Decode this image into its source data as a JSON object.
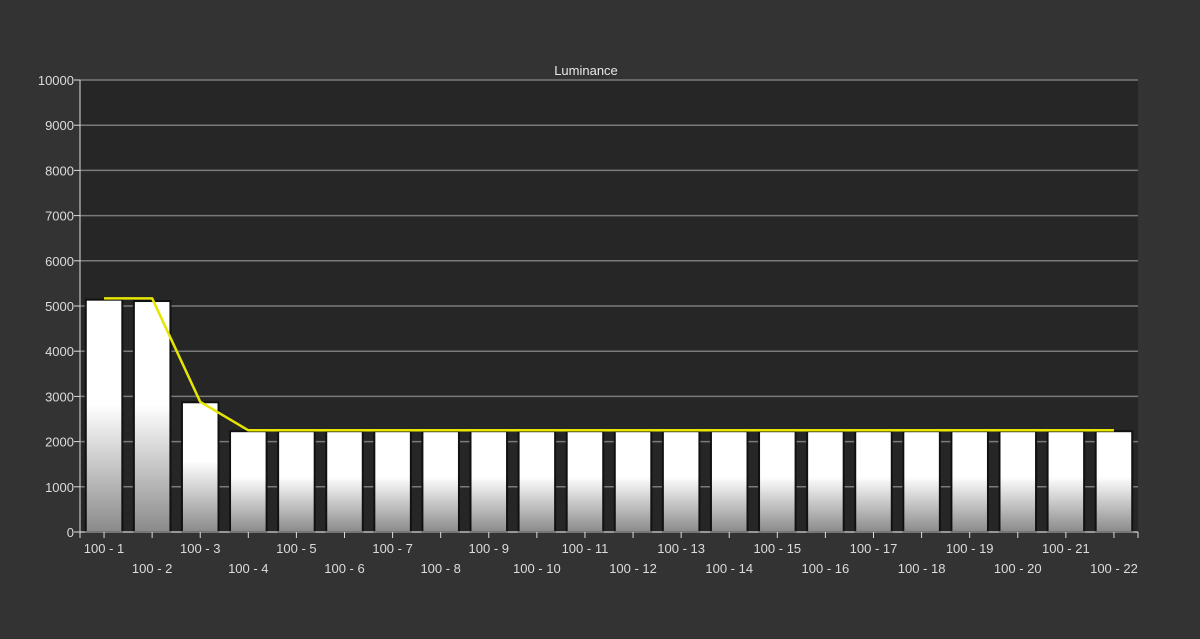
{
  "chart_data": {
    "type": "bar",
    "title": "Luminance",
    "categories": [
      "100 - 1",
      "100 - 2",
      "100 - 3",
      "100 - 4",
      "100 - 5",
      "100 - 6",
      "100 - 7",
      "100 - 8",
      "100 - 9",
      "100 - 10",
      "100 - 11",
      "100 - 12",
      "100 - 13",
      "100 - 14",
      "100 - 15",
      "100 - 16",
      "100 - 17",
      "100 - 18",
      "100 - 19",
      "100 - 20",
      "100 - 21",
      "100 - 22"
    ],
    "series": [
      {
        "kind": "bar",
        "values": [
          5140,
          5110,
          2870,
          2230,
          2230,
          2230,
          2230,
          2230,
          2230,
          2230,
          2230,
          2230,
          2230,
          2230,
          2230,
          2230,
          2230,
          2230,
          2230,
          2230,
          2230,
          2230
        ]
      },
      {
        "kind": "line",
        "values": [
          5170,
          5170,
          2880,
          2250,
          2250,
          2250,
          2250,
          2250,
          2250,
          2250,
          2250,
          2250,
          2250,
          2250,
          2250,
          2250,
          2250,
          2250,
          2250,
          2250,
          2250,
          2250
        ]
      }
    ],
    "yticks": [
      0,
      1000,
      2000,
      3000,
      4000,
      5000,
      6000,
      7000,
      8000,
      9000,
      10000
    ],
    "ylim": [
      0,
      10000
    ],
    "grid": "horizontal",
    "colors": {
      "background": "#333333",
      "plot_background": "#262626",
      "grid": "#7a7a7a",
      "axis_text": "#dcdcdc",
      "bar_top": "#ffffff",
      "bar_bottom": "#8a8a8a",
      "bar_outline": "#111111",
      "target_line": "#e6e600"
    }
  }
}
